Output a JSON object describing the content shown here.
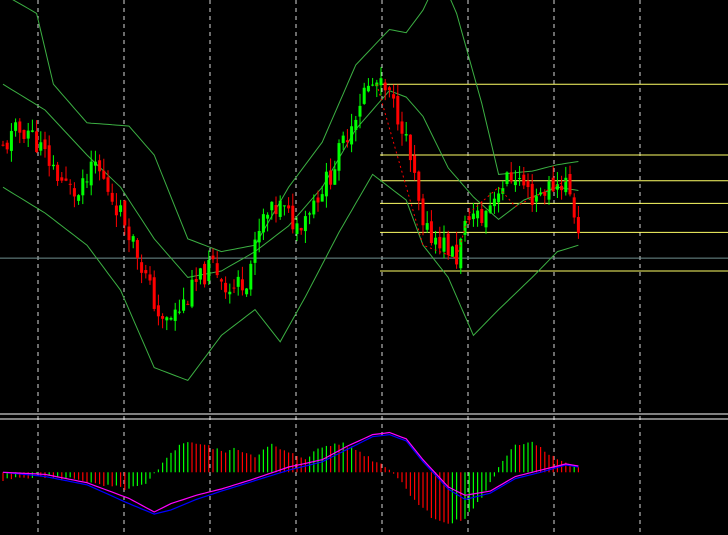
{
  "chart_data": [
    {
      "type": "candlestick",
      "panel": "price",
      "title": "",
      "x_count": 170,
      "ylim": [
        0,
        100
      ],
      "grid": true,
      "colors": {
        "bull": "#00ff00",
        "bear": "#ff0000",
        "band": "#3cb043",
        "fib": "#ffff66",
        "current_price_line": "#6f8f8f",
        "zigzag": "#ff0000",
        "grid": "#ffffff"
      },
      "close_anchors": [
        [
          0,
          70
        ],
        [
          3,
          75
        ],
        [
          6,
          76
        ],
        [
          10,
          68
        ],
        [
          14,
          60
        ],
        [
          18,
          55
        ],
        [
          22,
          65
        ],
        [
          26,
          55
        ],
        [
          30,
          45
        ],
        [
          34,
          30
        ],
        [
          38,
          15
        ],
        [
          42,
          20
        ],
        [
          46,
          28
        ],
        [
          50,
          34
        ],
        [
          54,
          26
        ],
        [
          58,
          30
        ],
        [
          62,
          48
        ],
        [
          66,
          52
        ],
        [
          70,
          46
        ],
        [
          74,
          54
        ],
        [
          78,
          62
        ],
        [
          82,
          75
        ],
        [
          86,
          88
        ],
        [
          89,
          90
        ],
        [
          92,
          86
        ],
        [
          95,
          78
        ],
        [
          98,
          60
        ],
        [
          100,
          44
        ],
        [
          104,
          42
        ],
        [
          108,
          36
        ],
        [
          111,
          50
        ],
        [
          114,
          48
        ],
        [
          118,
          58
        ],
        [
          122,
          62
        ],
        [
          126,
          55
        ],
        [
          130,
          58
        ],
        [
          134,
          60
        ],
        [
          137,
          45
        ]
      ],
      "bollinger": {
        "upper": [
          [
            0,
            118
          ],
          [
            8,
            112
          ],
          [
            12,
            90
          ],
          [
            20,
            78
          ],
          [
            30,
            77
          ],
          [
            36,
            68
          ],
          [
            44,
            42
          ],
          [
            52,
            38
          ],
          [
            60,
            40
          ],
          [
            68,
            58
          ],
          [
            76,
            72
          ],
          [
            84,
            96
          ],
          [
            92,
            107
          ],
          [
            96,
            106
          ],
          [
            100,
            113
          ],
          [
            104,
            124
          ],
          [
            108,
            112
          ],
          [
            114,
            84
          ],
          [
            118,
            62
          ],
          [
            126,
            63
          ],
          [
            132,
            65
          ],
          [
            137,
            66
          ]
        ],
        "middle": [
          [
            0,
            90
          ],
          [
            10,
            82
          ],
          [
            20,
            68
          ],
          [
            28,
            58
          ],
          [
            36,
            42
          ],
          [
            44,
            30
          ],
          [
            52,
            32
          ],
          [
            60,
            38
          ],
          [
            68,
            46
          ],
          [
            76,
            58
          ],
          [
            84,
            76
          ],
          [
            92,
            88
          ],
          [
            96,
            86
          ],
          [
            100,
            80
          ],
          [
            106,
            64
          ],
          [
            112,
            55
          ],
          [
            118,
            48
          ],
          [
            124,
            54
          ],
          [
            132,
            58
          ],
          [
            137,
            57
          ]
        ],
        "lower": [
          [
            0,
            58
          ],
          [
            10,
            50
          ],
          [
            20,
            40
          ],
          [
            28,
            26
          ],
          [
            36,
            2
          ],
          [
            44,
            -2
          ],
          [
            52,
            12
          ],
          [
            60,
            20
          ],
          [
            66,
            10
          ],
          [
            72,
            24
          ],
          [
            80,
            44
          ],
          [
            88,
            62
          ],
          [
            96,
            54
          ],
          [
            100,
            40
          ],
          [
            106,
            30
          ],
          [
            112,
            12
          ],
          [
            118,
            20
          ],
          [
            126,
            30
          ],
          [
            132,
            38
          ],
          [
            137,
            40
          ]
        ]
      },
      "fib_levels": [
        90,
        68,
        60,
        53,
        44,
        32
      ],
      "current_price": 36,
      "zigzag": [
        [
          89,
          90
        ],
        [
          100,
          40
        ],
        [
          108,
          36
        ],
        [
          111,
          50
        ],
        [
          118,
          58
        ],
        [
          122,
          52
        ],
        [
          134,
          60
        ]
      ]
    },
    {
      "type": "macd",
      "panel": "indicator",
      "title": "",
      "x_count": 170,
      "ylim": [
        -60,
        50
      ],
      "zero_level": 0,
      "colors": {
        "hist_up": "#00ff00",
        "hist_down": "#ff0000",
        "main": "#ff00ff",
        "signal": "#0000ff"
      },
      "hist_anchors": [
        [
          0,
          -8
        ],
        [
          6,
          -4
        ],
        [
          10,
          -4
        ],
        [
          14,
          -6
        ],
        [
          18,
          -6
        ],
        [
          22,
          -12
        ],
        [
          26,
          -14
        ],
        [
          30,
          -16
        ],
        [
          34,
          -12
        ],
        [
          37,
          2
        ],
        [
          40,
          20
        ],
        [
          44,
          30
        ],
        [
          48,
          26
        ],
        [
          52,
          20
        ],
        [
          56,
          22
        ],
        [
          60,
          16
        ],
        [
          64,
          26
        ],
        [
          68,
          18
        ],
        [
          72,
          14
        ],
        [
          76,
          24
        ],
        [
          80,
          28
        ],
        [
          84,
          22
        ],
        [
          88,
          12
        ],
        [
          92,
          4
        ],
        [
          95,
          -10
        ],
        [
          98,
          -26
        ],
        [
          102,
          -42
        ],
        [
          106,
          -50
        ],
        [
          110,
          -44
        ],
        [
          114,
          -24
        ],
        [
          118,
          4
        ],
        [
          122,
          26
        ],
        [
          126,
          30
        ],
        [
          130,
          18
        ],
        [
          134,
          8
        ],
        [
          137,
          4
        ]
      ],
      "main_anchors": [
        [
          0,
          0
        ],
        [
          10,
          -2
        ],
        [
          20,
          -10
        ],
        [
          30,
          -25
        ],
        [
          36,
          -38
        ],
        [
          40,
          -30
        ],
        [
          46,
          -22
        ],
        [
          52,
          -16
        ],
        [
          60,
          -6
        ],
        [
          68,
          5
        ],
        [
          76,
          12
        ],
        [
          82,
          25
        ],
        [
          88,
          36
        ],
        [
          92,
          38
        ],
        [
          96,
          32
        ],
        [
          100,
          12
        ],
        [
          106,
          -14
        ],
        [
          110,
          -22
        ],
        [
          116,
          -18
        ],
        [
          122,
          -4
        ],
        [
          128,
          2
        ],
        [
          134,
          8
        ],
        [
          137,
          6
        ]
      ],
      "signal_anchors": [
        [
          0,
          0
        ],
        [
          10,
          -4
        ],
        [
          20,
          -12
        ],
        [
          30,
          -30
        ],
        [
          36,
          -40
        ],
        [
          40,
          -36
        ],
        [
          46,
          -26
        ],
        [
          52,
          -18
        ],
        [
          60,
          -8
        ],
        [
          68,
          2
        ],
        [
          76,
          10
        ],
        [
          82,
          22
        ],
        [
          88,
          34
        ],
        [
          92,
          36
        ],
        [
          96,
          30
        ],
        [
          100,
          10
        ],
        [
          106,
          -16
        ],
        [
          110,
          -26
        ],
        [
          116,
          -20
        ],
        [
          122,
          -6
        ],
        [
          128,
          0
        ],
        [
          134,
          7
        ],
        [
          137,
          5
        ]
      ]
    }
  ]
}
